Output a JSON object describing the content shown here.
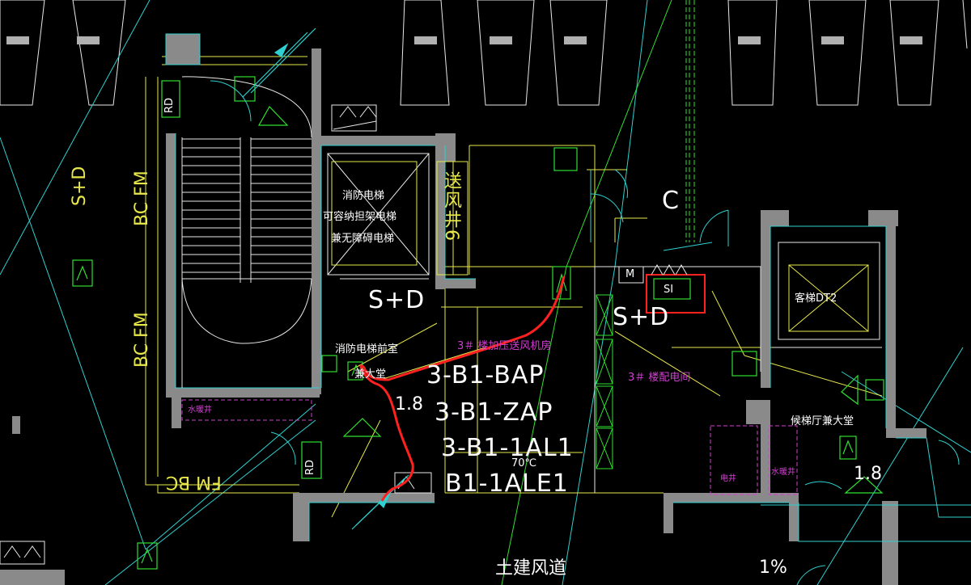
{
  "labels": {
    "sd_left": "S+D",
    "bc_fm_top": "BC FM",
    "bc_fm_mid": "BC FM",
    "fm_bc_bottom": "FM BC",
    "rd_top": "RD",
    "rd_bottom": "RD",
    "water_well_left": "水暖井",
    "fire_elevator_1": "消防电梯",
    "fire_elevator_2": "可容纳担架电梯",
    "fire_elevator_3": "兼无障碍电梯",
    "air_shaft": "送风井6",
    "sd_center": "S+D",
    "fire_lobby": "消防电梯前室",
    "fire_lobby_2": "兼大堂",
    "pressurized_room": "3＃ 楼加压送风机房",
    "bap": "3-B1-BAP",
    "zap": "3-B1-ZAP",
    "al1": "3-B1-1AL1",
    "ale1": "B1-1ALE1",
    "dim_18_left": "1.8",
    "temp_70": "70℃",
    "c_label": "C",
    "m_label": "M",
    "si_label": "SI",
    "sd_right": "S+D",
    "dist_room": "3＃ 楼配电间",
    "passenger_elevator": "客梯DT2",
    "elevator_hall": "候梯厅兼大堂",
    "electric_well": "电井",
    "water_well_right": "水暖井",
    "dim_18_right": "1.8",
    "civil_duct": "土建风道",
    "slope": "1%"
  },
  "colors": {
    "wall": "#8a8a8a",
    "cyan": "#2fd0d0",
    "yellow": "#e8e84a",
    "green": "#30e030",
    "magenta": "#d040d0",
    "red": "#ff2020",
    "white": "#ffffff"
  }
}
